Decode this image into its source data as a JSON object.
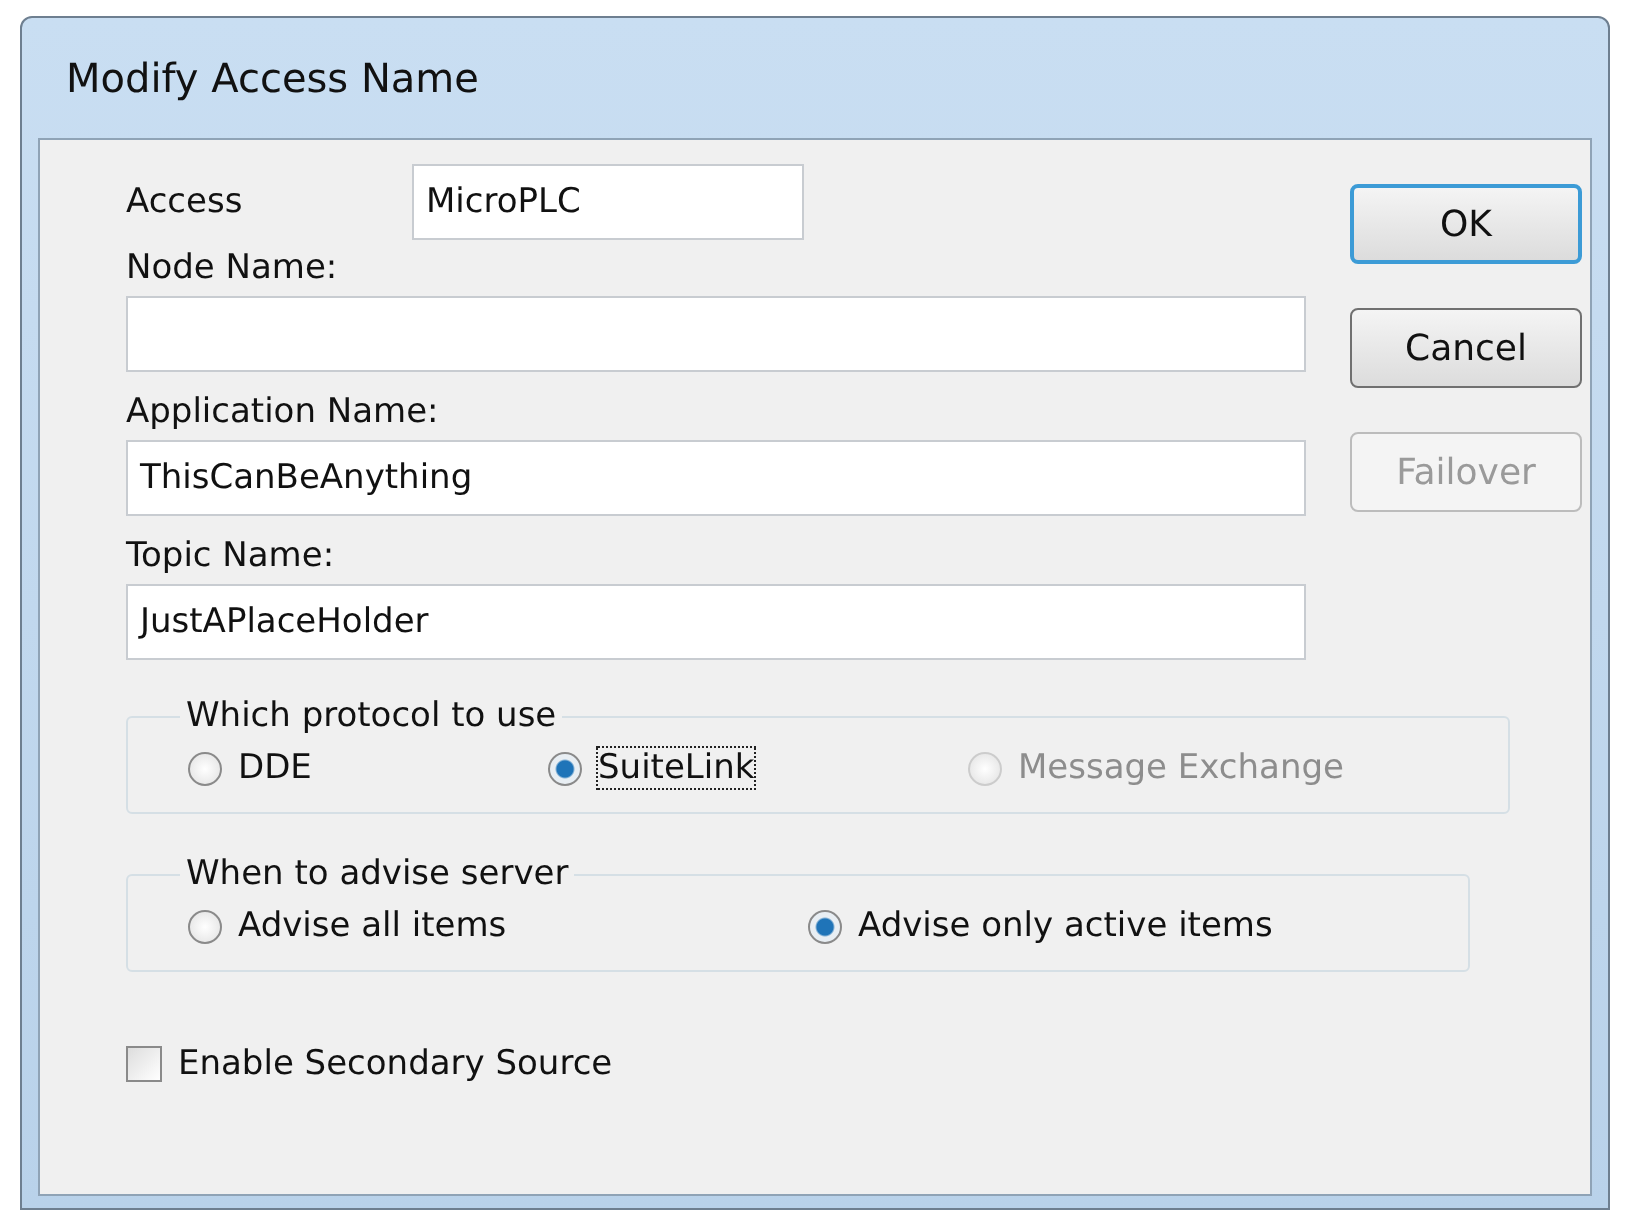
{
  "window": {
    "title": "Modify Access Name"
  },
  "fields": [
    {
      "label": "Access",
      "value": "MicroPLC",
      "inline": true
    },
    {
      "label": "Node Name:",
      "inline": false
    },
    {
      "label": "Application Name:",
      "value": "ThisCanBeAnything",
      "inline": false
    },
    {
      "label": "Topic Name:",
      "value": "JustAPlaceHolder",
      "inline": false
    }
  ],
  "buttons": [
    {
      "label": "OK",
      "default": true,
      "disabled": false
    },
    {
      "label": "Cancel",
      "default": false,
      "disabled": false
    },
    {
      "label": "Failover",
      "default": false,
      "disabled": true
    }
  ],
  "groups": [
    {
      "title": "Which protocol to use",
      "options": [
        {
          "label": "DDE",
          "selected": false,
          "disabled": false,
          "focused": false
        },
        {
          "label": "SuiteLink",
          "selected": true,
          "disabled": false,
          "focused": true
        },
        {
          "label": "Message Exchange",
          "selected": false,
          "disabled": true,
          "focused": false
        }
      ]
    },
    {
      "title": "When to advise server",
      "options": [
        {
          "label": "Advise all items",
          "selected": false,
          "disabled": false,
          "focused": false
        },
        {
          "label": "Advise only active items",
          "selected": true,
          "disabled": false,
          "focused": false
        }
      ]
    }
  ],
  "checkbox": {
    "label": "Enable Secondary Source",
    "checked": false
  }
}
